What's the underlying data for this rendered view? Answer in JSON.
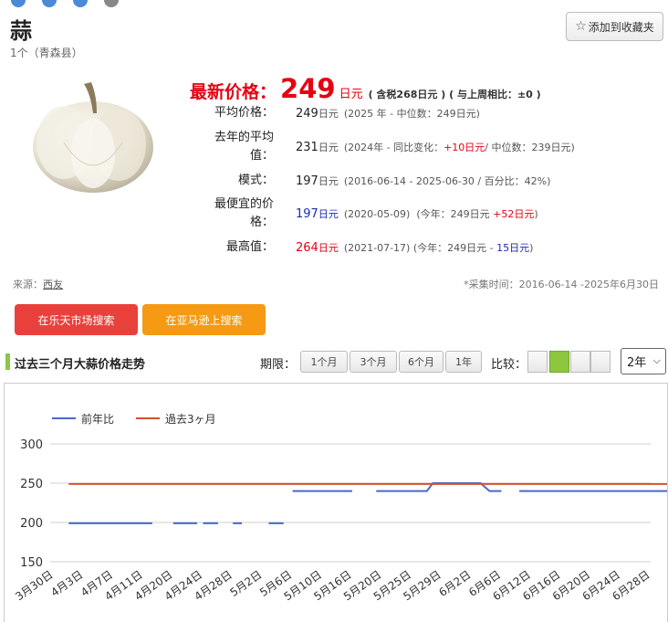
{
  "product": {
    "title": "蒜",
    "subtitle": "1个（青森县）"
  },
  "favorite": {
    "label": "添加到收藏夹",
    "icon": "star-outline-icon"
  },
  "price": {
    "label": "最新价格：",
    "value": "249",
    "unit": "日元",
    "extra": "( 含税268日元 ) ( 与上周相比：±0 )"
  },
  "stats": {
    "avg": {
      "label": "平均价格：",
      "value": "249",
      "unit": "日元",
      "detail": "(2025 年 - 中位数：249日元)"
    },
    "last_year": {
      "label1": "去年的平均",
      "label2": "值：",
      "value": "231",
      "unit": "日元",
      "detail_a": "(2024年 - 同比变化：",
      "change": "+10日元",
      "detail_b": "/ 中位数：239日元)"
    },
    "mode": {
      "label": "模式：",
      "value": "197",
      "unit": "日元",
      "detail": "(2016-06-14 - 2025-06-30 / 百分比：42%)"
    },
    "cheapest": {
      "label1": "最便宜的价",
      "label2": "格：",
      "value": "197",
      "unit": "日元",
      "detail_a": "(2020-05-09)",
      "detail_b": "(今年：249日元",
      "change": "+52日元",
      "detail_c": ")"
    },
    "highest": {
      "label": "最高值：",
      "value": "264",
      "unit": "日元",
      "detail_a": "(2021-07-17) (今年：249日元 -",
      "change": "15日元",
      "detail_b": ")"
    }
  },
  "source": {
    "label": "来源：",
    "link": "西友"
  },
  "collect_time": "*采集时间：2016-06-14 -2025年6月30日",
  "buttons": {
    "rakuten": "在乐天市场搜索",
    "amazon": "在亚马逊上搜索"
  },
  "section_title": "过去三个月大蒜价格走势",
  "period": {
    "label": "期限：",
    "options": [
      "1个月",
      "3个月",
      "6个月",
      "1年"
    ]
  },
  "compare": {
    "label": "比较："
  },
  "range_select": "2年",
  "colors": {
    "accent_red": "#e60012",
    "blue_series": "#4a68c8",
    "red_series": "#d2522a",
    "green": "#8dc63f"
  },
  "chart_data": {
    "type": "line",
    "ylim": [
      150,
      300
    ],
    "yticks": [
      150,
      200,
      250,
      300
    ],
    "categories": [
      "3月30日",
      "4月3日",
      "4月7日",
      "4月11日",
      "4月20日",
      "4月24日",
      "4月28日",
      "5月2日",
      "5月6日",
      "5月10日",
      "5月16日",
      "5月20日",
      "5月25日",
      "5月29日",
      "6月2日",
      "6月6日",
      "6月12日",
      "6月16日",
      "6月20日",
      "6月24日",
      "6月28日"
    ],
    "series": [
      {
        "name": "前年比",
        "segments": [
          [
            [
              0.5,
              199
            ],
            [
              3.3,
              199
            ]
          ],
          [
            [
              4.0,
              199
            ],
            [
              4.8,
              199
            ]
          ],
          [
            [
              5.0,
              199
            ],
            [
              5.5,
              199
            ]
          ],
          [
            [
              6.0,
              199
            ],
            [
              6.3,
              199
            ]
          ],
          [
            [
              7.2,
              199
            ],
            [
              7.7,
              199
            ]
          ],
          [
            [
              8.0,
              240
            ],
            [
              10.0,
              240
            ]
          ],
          [
            [
              10.8,
              240
            ],
            [
              12.5,
              240
            ],
            [
              12.7,
              250
            ],
            [
              14.3,
              250
            ],
            [
              14.6,
              240
            ],
            [
              15.0,
              240
            ]
          ],
          [
            [
              15.6,
              240
            ],
            [
              21.0,
              240
            ]
          ]
        ]
      },
      {
        "name": "過去3ヶ月",
        "segments": [
          [
            [
              0.5,
              249
            ],
            [
              21.0,
              249
            ]
          ]
        ]
      }
    ]
  }
}
